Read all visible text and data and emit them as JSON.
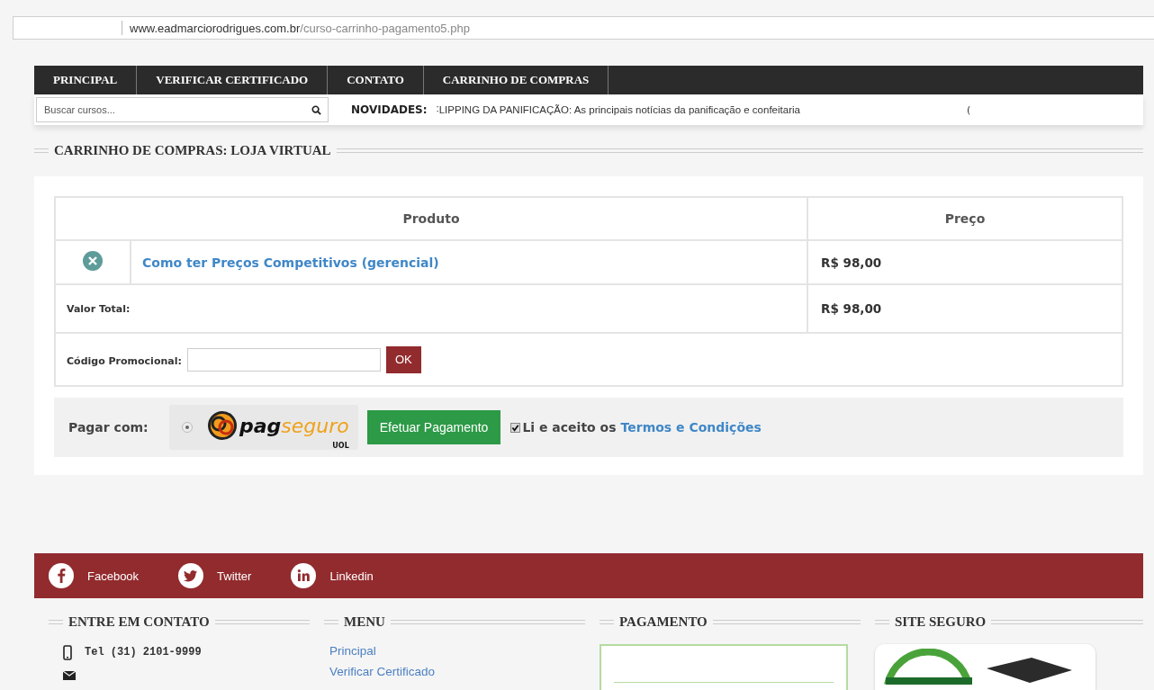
{
  "address_bar": {
    "domain": "www.eadmarciorodrigues.com.br",
    "path": "/curso-carrinho-pagamento5.php"
  },
  "nav": {
    "items": [
      {
        "label": "PRINCIPAL"
      },
      {
        "label": "VERIFICAR CERTIFICADO"
      },
      {
        "label": "CONTATO"
      },
      {
        "label": "CARRINHO DE COMPRAS"
      }
    ]
  },
  "search": {
    "placeholder": "Buscar cursos..."
  },
  "news": {
    "label": "NOVIDADES:",
    "text": "˸LIPPING DA PANIFICAÇÃO: As principais notícias da panificação e confeitaria",
    "next_fragment": "("
  },
  "section_title": "CARRINHO DE COMPRAS: LOJA VIRTUAL",
  "cart": {
    "columns": [
      "Produto",
      "Preço"
    ],
    "items": [
      {
        "name": "Como ter Preços Competitivos (gerencial)",
        "price": "R$ 98,00"
      }
    ],
    "total_label": "Valor Total:",
    "total_value": "R$ 98,00",
    "promo_label": "Código Promocional:",
    "promo_button": "OK"
  },
  "payment": {
    "label": "Pagar com:",
    "method_selected": true,
    "logo": {
      "pag": "pag",
      "seguro": "seguro",
      "uol": "UOL"
    },
    "pay_button": "Efetuar Pagamento",
    "terms": {
      "checked": true,
      "text": "Li e aceito os",
      "link": "Termos e Condições"
    }
  },
  "social": [
    {
      "kind": "facebook",
      "label": "Facebook"
    },
    {
      "kind": "twitter",
      "label": "Twitter"
    },
    {
      "kind": "linkedin",
      "label": "Linkedin"
    }
  ],
  "footer": {
    "contact": {
      "title": "ENTRE EM CONTATO",
      "phone": "Tel (31) 2101-9999"
    },
    "menu": {
      "title": "MENU",
      "links": [
        "Principal",
        "Verificar Certificado"
      ]
    },
    "pagamento": {
      "title": "PAGAMENTO"
    },
    "site_seguro": {
      "title": "SITE SEGURO"
    }
  }
}
